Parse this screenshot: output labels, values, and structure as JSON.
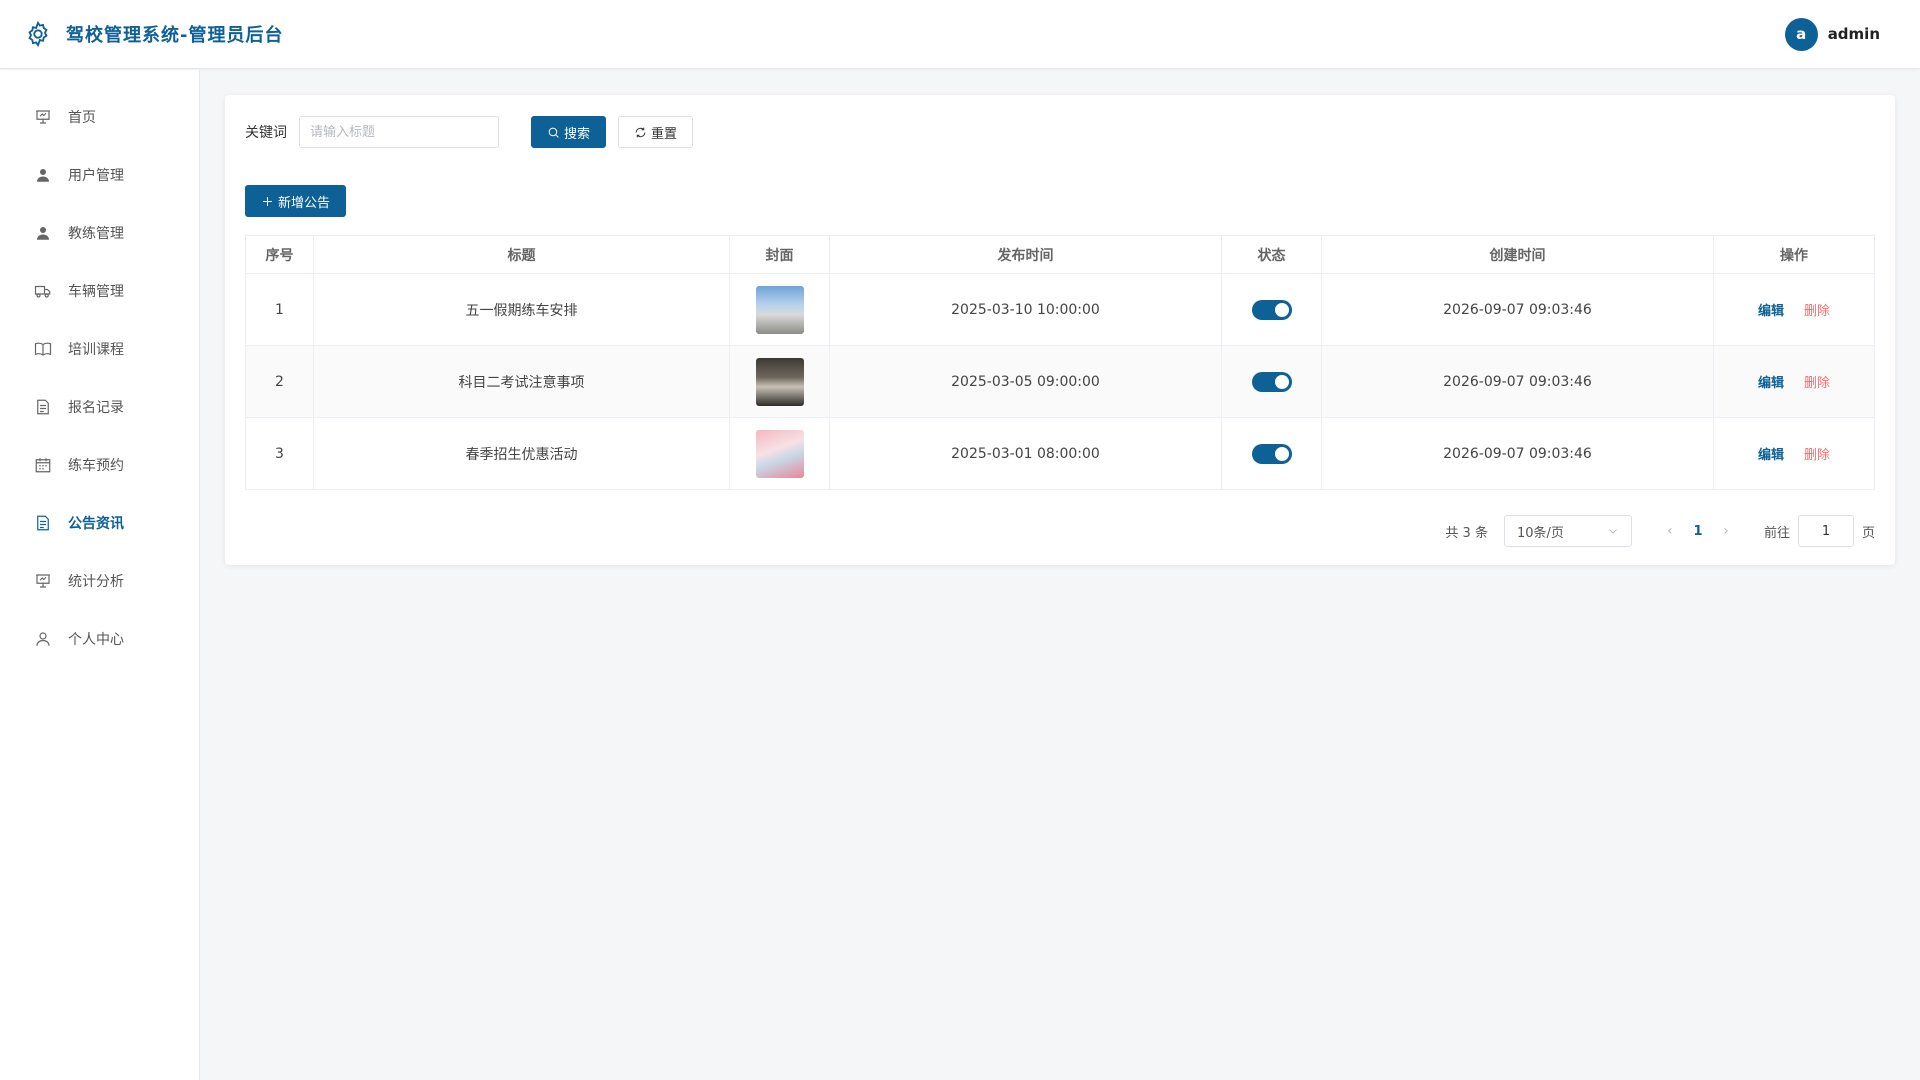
{
  "header": {
    "title": "驾校管理系统-管理员后台",
    "avatar_letter": "a",
    "username": "admin"
  },
  "sidebar": {
    "items": [
      {
        "label": "首页",
        "icon": "presentation-icon"
      },
      {
        "label": "用户管理",
        "icon": "user-icon"
      },
      {
        "label": "教练管理",
        "icon": "user-icon"
      },
      {
        "label": "车辆管理",
        "icon": "truck-icon"
      },
      {
        "label": "培训课程",
        "icon": "book-icon"
      },
      {
        "label": "报名记录",
        "icon": "document-icon"
      },
      {
        "label": "练车预约",
        "icon": "calendar-icon"
      },
      {
        "label": "公告资讯",
        "icon": "document-icon"
      },
      {
        "label": "统计分析",
        "icon": "presentation-icon"
      },
      {
        "label": "个人中心",
        "icon": "user-outline-icon"
      }
    ],
    "active_index": 7
  },
  "search": {
    "label": "关键词",
    "placeholder": "请输入标题",
    "value": "",
    "search_button": "搜索",
    "reset_button": "重置"
  },
  "toolbar": {
    "add_button": "新增公告"
  },
  "table": {
    "columns": [
      "序号",
      "标题",
      "封面",
      "发布时间",
      "状态",
      "创建时间",
      "操作"
    ],
    "rows": [
      {
        "index": "1",
        "title": "五一假期练车安排",
        "publish_time": "2025-03-10 10:00:00",
        "status": true,
        "created_time": "2026-09-07 09:03:46",
        "edit": "编辑",
        "delete": "删除"
      },
      {
        "index": "2",
        "title": "科目二考试注意事项",
        "publish_time": "2025-03-05 09:00:00",
        "status": true,
        "created_time": "2026-09-07 09:03:46",
        "edit": "编辑",
        "delete": "删除"
      },
      {
        "index": "3",
        "title": "春季招生优惠活动",
        "publish_time": "2025-03-01 08:00:00",
        "status": true,
        "created_time": "2026-09-07 09:03:46",
        "edit": "编辑",
        "delete": "删除"
      }
    ]
  },
  "pagination": {
    "total_text": "共 3 条",
    "page_size": "10条/页",
    "current_page": "1",
    "goto_label": "前往",
    "goto_value": "1",
    "goto_suffix": "页"
  },
  "colors": {
    "primary": "#0e6196",
    "danger": "#f56c6c"
  }
}
